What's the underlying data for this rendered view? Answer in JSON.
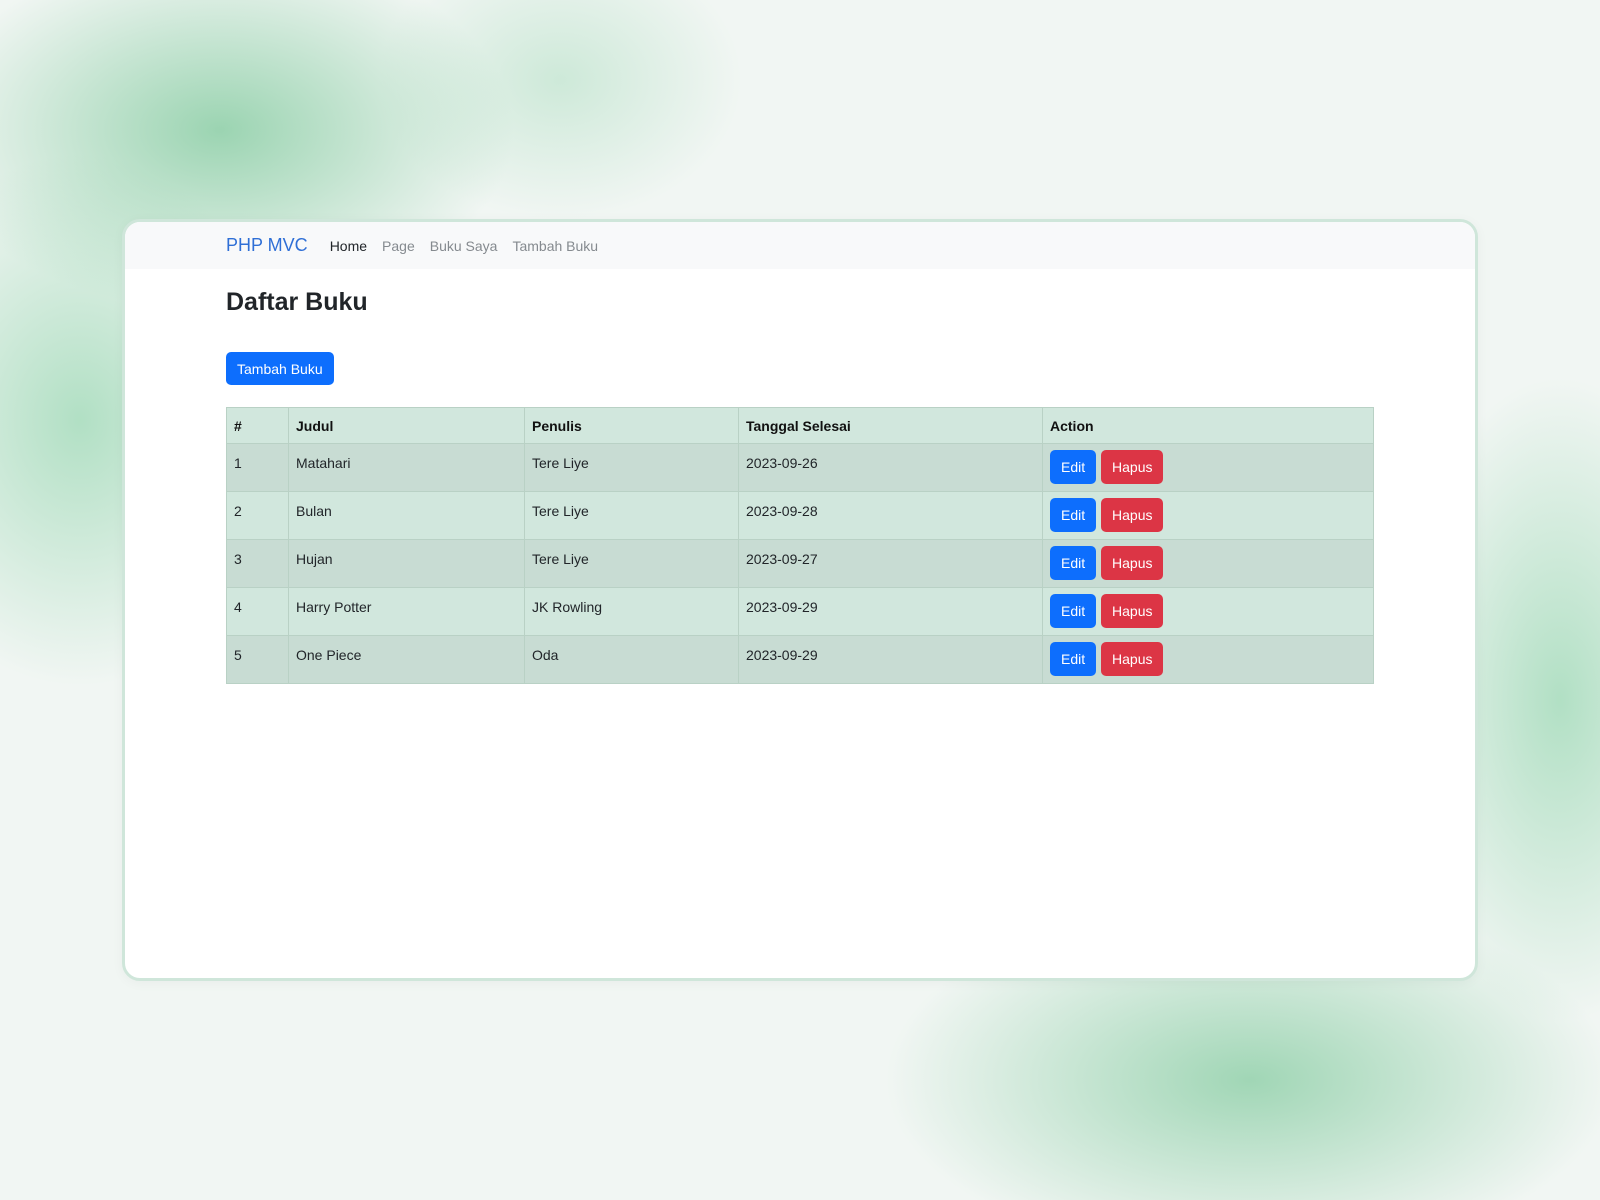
{
  "navbar": {
    "brand": "PHP MVC",
    "links": [
      {
        "label": "Home",
        "active": true
      },
      {
        "label": "Page",
        "active": false
      },
      {
        "label": "Buku Saya",
        "active": false
      },
      {
        "label": "Tambah Buku",
        "active": false
      }
    ]
  },
  "page": {
    "title": "Daftar Buku",
    "add_button": "Tambah Buku"
  },
  "table": {
    "headers": [
      "#",
      "Judul",
      "Penulis",
      "Tanggal Selesai",
      "Action"
    ],
    "rows": [
      {
        "no": "1",
        "judul": "Matahari",
        "penulis": "Tere Liye",
        "tanggal": "2023-09-26"
      },
      {
        "no": "2",
        "judul": "Bulan",
        "penulis": "Tere Liye",
        "tanggal": "2023-09-28"
      },
      {
        "no": "3",
        "judul": "Hujan",
        "penulis": "Tere Liye",
        "tanggal": "2023-09-27"
      },
      {
        "no": "4",
        "judul": "Harry Potter",
        "penulis": "JK Rowling",
        "tanggal": "2023-09-29"
      },
      {
        "no": "5",
        "judul": "One Piece",
        "penulis": "Oda",
        "tanggal": "2023-09-29"
      }
    ],
    "edit_label": "Edit",
    "delete_label": "Hapus"
  },
  "colors": {
    "primary": "#0d6efd",
    "danger": "#dc3545",
    "table_bg": "#d1e7dd",
    "brand": "#2f6fd6"
  }
}
